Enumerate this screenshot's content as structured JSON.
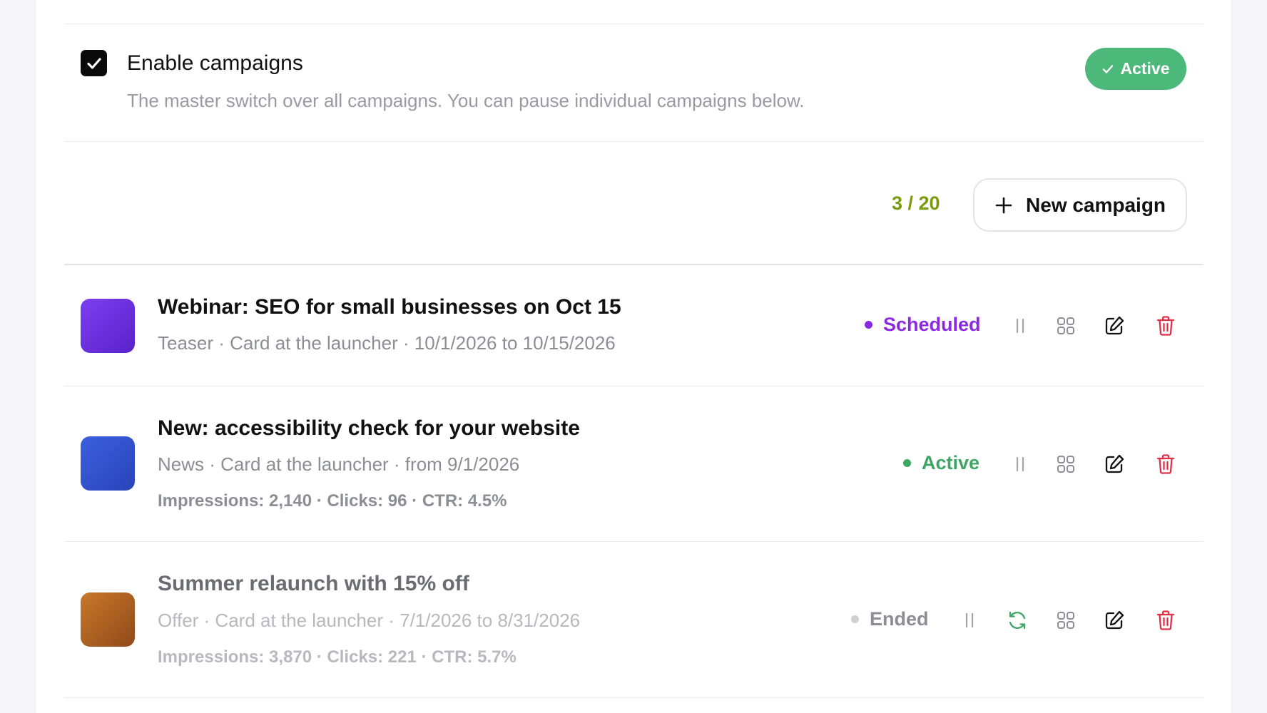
{
  "master": {
    "title": "Enable campaigns",
    "description": "The master switch over all campaigns. You can pause individual campaigns below.",
    "checked": true,
    "status_label": "Active",
    "status_color": "#4cb97a"
  },
  "toolbar": {
    "count": "3 / 20",
    "count_color": "#7a9a0e",
    "new_button_label": "New campaign"
  },
  "campaigns": [
    {
      "title": "Webinar: SEO for small businesses on Oct 15",
      "meta": "Teaser · Card at the launcher · 10/1/2026 to 10/15/2026",
      "stats": "",
      "status": "Scheduled",
      "status_color": "#8a2be2",
      "thumb_colors": [
        "#7b3ff0",
        "#5a22c9"
      ],
      "actions": [
        "pause-icon",
        "grid-icon",
        "edit-icon",
        "trash-icon"
      ]
    },
    {
      "title": "New: accessibility check for your website",
      "meta": "News · Card at the launcher · from 9/1/2026",
      "stats": "Impressions: 2,140 · Clicks: 96 · CTR: 4.5%",
      "status": "Active",
      "status_color": "#3fa565",
      "thumb_colors": [
        "#3c5fe0",
        "#2a44b8"
      ],
      "actions": [
        "pause-icon",
        "grid-icon",
        "edit-icon",
        "trash-icon"
      ]
    },
    {
      "title": "Summer relaunch with 15% off",
      "meta": "Offer · Card at the launcher · 7/1/2026 to 8/31/2026",
      "stats": "Impressions: 3,870 · Clicks: 221 · CTR: 5.7%",
      "status": "Ended",
      "status_color": "#8d8d95",
      "thumb_colors": [
        "#c9782a",
        "#8f4a1a"
      ],
      "actions": [
        "pause-icon",
        "refresh-icon",
        "grid-icon",
        "edit-icon",
        "trash-icon"
      ]
    }
  ]
}
